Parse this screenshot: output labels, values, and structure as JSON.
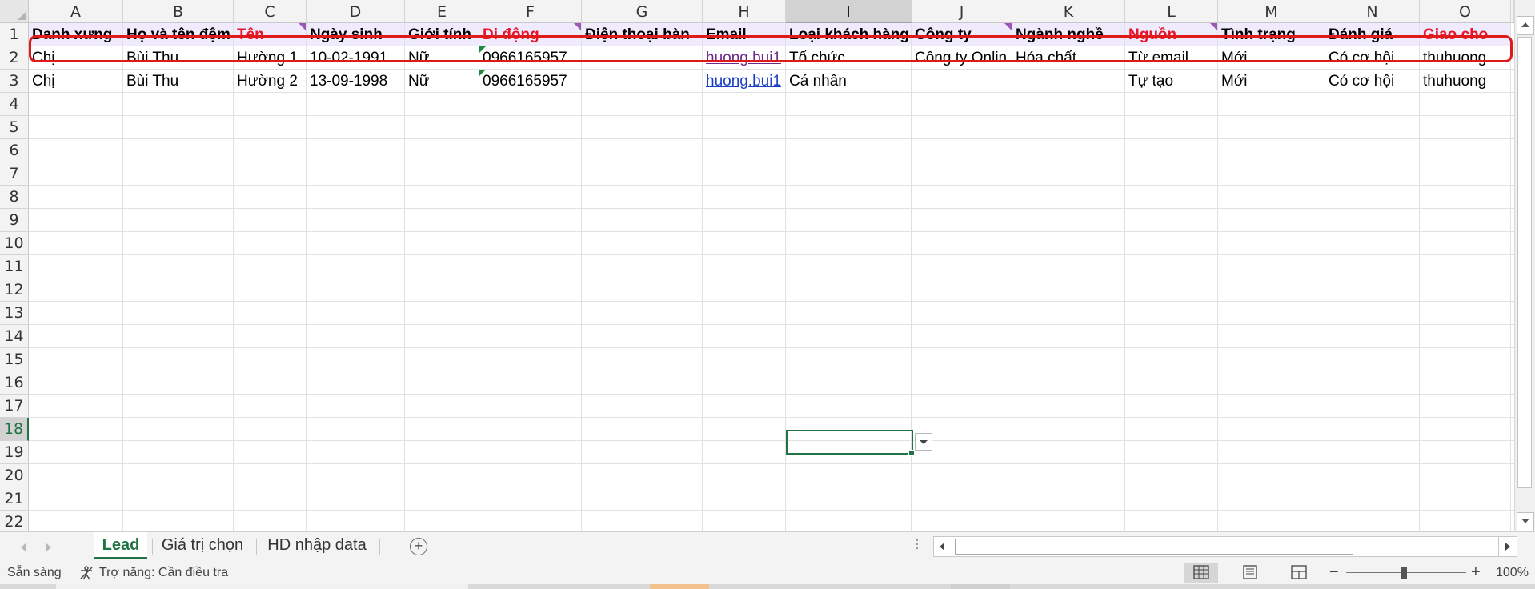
{
  "columns": [
    {
      "letter": "A",
      "w": 118
    },
    {
      "letter": "B",
      "w": 138
    },
    {
      "letter": "C",
      "w": 91
    },
    {
      "letter": "D",
      "w": 123
    },
    {
      "letter": "E",
      "w": 93
    },
    {
      "letter": "F",
      "w": 128
    },
    {
      "letter": "G",
      "w": 151
    },
    {
      "letter": "H",
      "w": 104
    },
    {
      "letter": "I",
      "w": 157
    },
    {
      "letter": "J",
      "w": 126
    },
    {
      "letter": "K",
      "w": 141
    },
    {
      "letter": "L",
      "w": 116
    },
    {
      "letter": "M",
      "w": 134
    },
    {
      "letter": "N",
      "w": 118
    },
    {
      "letter": "O",
      "w": 114
    }
  ],
  "row_numbers": [
    "1",
    "2",
    "3",
    "4",
    "5",
    "6",
    "7",
    "8",
    "9",
    "10",
    "11",
    "12",
    "13",
    "14",
    "15",
    "16",
    "17",
    "18",
    "19",
    "20",
    "21",
    "22"
  ],
  "active_column": "I",
  "active_row": "18",
  "header_row": [
    {
      "text": "Danh xưng",
      "required": false,
      "note": false
    },
    {
      "text": "Họ và tên đệm",
      "required": false,
      "note": false
    },
    {
      "text": "Tên",
      "required": true,
      "note": true
    },
    {
      "text": "Ngày sinh",
      "required": false,
      "note": false
    },
    {
      "text": "Giới tính",
      "required": false,
      "note": false
    },
    {
      "text": "Di động",
      "required": true,
      "note": true
    },
    {
      "text": "Điện thoại bàn",
      "required": false,
      "note": false
    },
    {
      "text": "Email",
      "required": false,
      "note": false
    },
    {
      "text": "Loại khách hàng",
      "required": false,
      "note": false
    },
    {
      "text": "Công ty",
      "required": false,
      "note": true
    },
    {
      "text": "Ngành nghề",
      "required": false,
      "note": false
    },
    {
      "text": "Nguồn",
      "required": true,
      "note": true
    },
    {
      "text": "Tình trạng",
      "required": false,
      "note": false
    },
    {
      "text": "Đánh giá",
      "required": false,
      "note": false
    },
    {
      "text": "Giao cho",
      "required": true,
      "note": false
    }
  ],
  "data_rows": [
    [
      "Chị",
      "Bùi Thu",
      "Hường 1",
      "10-02-1991",
      "Nữ",
      "0966165957",
      "",
      "huong.bui1",
      "Tổ chức",
      "Công ty Onlin",
      "Hóa chất",
      "Từ email",
      "Mới",
      "Có cơ hội",
      "thuhuong"
    ],
    [
      "Chị",
      "Bùi Thu",
      "Hường 2",
      "13-09-1998",
      "Nữ",
      "0966165957",
      "",
      "huong.bui1",
      "Cá nhân",
      "",
      "",
      "Tự tạo",
      "Mới",
      "Có cơ hội",
      "thuhuong"
    ]
  ],
  "sheet_tabs": [
    "Lead",
    "Giá trị chọn",
    "HD nhập data"
  ],
  "active_tab": "Lead",
  "status": {
    "ready": "Sẵn sàng",
    "accessibility": "Trợ năng: Cần điều tra",
    "zoom": "100%",
    "zoom_minus": "−",
    "zoom_plus": "+"
  },
  "colors": {
    "accent": "#217346",
    "required_header": "#e8152a",
    "header_fill": "#efeafc",
    "outline": "#e01a1a",
    "link": "#1a3fc6",
    "visited_link": "#6d2a8a"
  }
}
